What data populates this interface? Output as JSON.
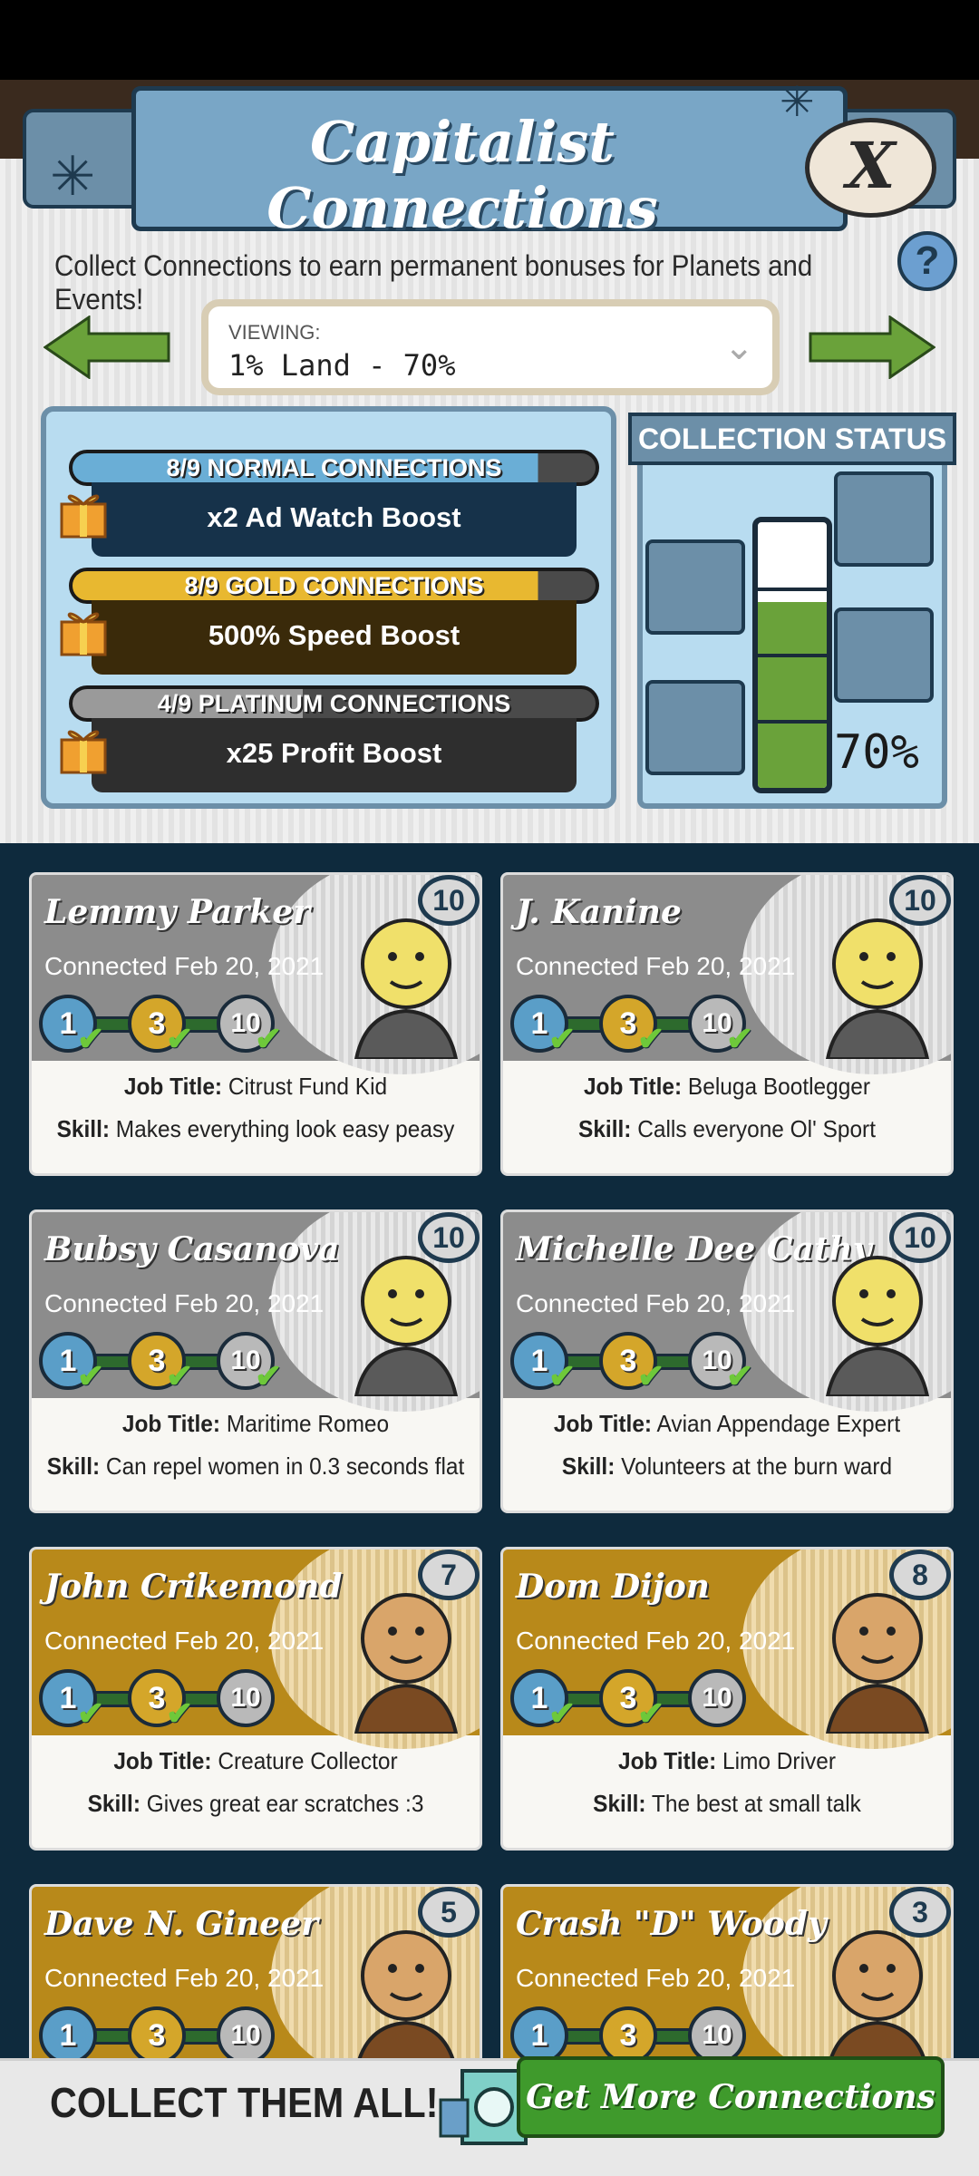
{
  "header": {
    "title": "Capitalist Connections",
    "close_label": "X",
    "subtitle": "Collect Connections to earn permanent bonuses for Planets and Events!",
    "help_label": "?"
  },
  "viewing": {
    "label": "VIEWING:",
    "value": "1% Land - 70%"
  },
  "groups": [
    {
      "head": "8/9 NORMAL CONNECTIONS",
      "reward": "x2 Ad Watch Boost",
      "progress": 0.89,
      "color": "#6aaed6"
    },
    {
      "head": "8/9 GOLD CONNECTIONS",
      "reward": "500% Speed Boost",
      "progress": 0.89,
      "color": "#e8b830"
    },
    {
      "head": "4/9 PLATINUM CONNECTIONS",
      "reward": "x25 Profit Boost",
      "progress": 0.44,
      "color": "#9a9a9a"
    }
  ],
  "collection_status": {
    "title": "COLLECTION STATUS",
    "percent": "70%",
    "fill": 0.7
  },
  "cards": [
    {
      "name": "Lemmy Parker",
      "connected": "Connected Feb 20, 2021",
      "level": "10",
      "tier": "gray",
      "job_label": "Job Title:",
      "job": "Citrust Fund Kid",
      "skill_label": "Skill:",
      "skill": "Makes everything look easy peasy",
      "badges": [
        "1",
        "3",
        "10"
      ],
      "checks": [
        true,
        true,
        true
      ]
    },
    {
      "name": "J. Kanine",
      "connected": "Connected Feb 20, 2021",
      "level": "10",
      "tier": "gray",
      "job_label": "Job Title:",
      "job": "Beluga Bootlegger",
      "skill_label": "Skill:",
      "skill": "Calls everyone Ol' Sport",
      "badges": [
        "1",
        "3",
        "10"
      ],
      "checks": [
        true,
        true,
        true
      ]
    },
    {
      "name": "Bubsy Casanova",
      "connected": "Connected Feb 20, 2021",
      "level": "10",
      "tier": "gray",
      "job_label": "Job Title:",
      "job": "Maritime Romeo",
      "skill_label": "Skill:",
      "skill": "Can repel women in 0.3 seconds flat",
      "badges": [
        "1",
        "3",
        "10"
      ],
      "checks": [
        true,
        true,
        true
      ]
    },
    {
      "name": "Michelle Dee Cathy",
      "connected": "Connected Feb 20, 2021",
      "level": "10",
      "tier": "gray",
      "job_label": "Job Title:",
      "job": "Avian Appendage Expert",
      "skill_label": "Skill:",
      "skill": "Volunteers at the burn ward",
      "badges": [
        "1",
        "3",
        "10"
      ],
      "checks": [
        true,
        true,
        true
      ]
    },
    {
      "name": "John Crikemond",
      "connected": "Connected Feb 20, 2021",
      "level": "7",
      "tier": "gold",
      "job_label": "Job Title:",
      "job": "Creature Collector",
      "skill_label": "Skill:",
      "skill": "Gives great ear scratches :3",
      "badges": [
        "1",
        "3",
        "10"
      ],
      "checks": [
        true,
        true,
        false
      ]
    },
    {
      "name": "Dom Dijon",
      "connected": "Connected Feb 20, 2021",
      "level": "8",
      "tier": "gold",
      "job_label": "Job Title:",
      "job": "Limo Driver",
      "skill_label": "Skill:",
      "skill": "The best at small talk",
      "badges": [
        "1",
        "3",
        "10"
      ],
      "checks": [
        true,
        true,
        false
      ]
    },
    {
      "name": "Dave N. Gineer",
      "connected": "Connected Feb 20, 2021",
      "level": "5",
      "tier": "gold",
      "job_label": "",
      "job": "",
      "skill_label": "",
      "skill": "",
      "badges": [
        "1",
        "3",
        "10"
      ],
      "checks": [
        false,
        false,
        false
      ]
    },
    {
      "name": "Crash \"D\" Woody",
      "connected": "Connected Feb 20, 2021",
      "level": "3",
      "tier": "gold",
      "job_label": "",
      "job": "",
      "skill_label": "",
      "skill": "",
      "badges": [
        "1",
        "3",
        "10"
      ],
      "checks": [
        false,
        false,
        false
      ]
    }
  ],
  "footer": {
    "text": "COLLECT THEM ALL!",
    "button": "Get More Connections"
  },
  "colors": {
    "panel_blue": "#79a6c6",
    "gold": "#b8891a",
    "green_button": "#3f9a2c",
    "dark_bg": "#0e2a3d"
  },
  "icons": [
    "close-icon",
    "help-icon",
    "arrow-left-icon",
    "arrow-right-icon",
    "chevron-down-icon",
    "gift-icon",
    "check-icon",
    "safe-icon"
  ]
}
